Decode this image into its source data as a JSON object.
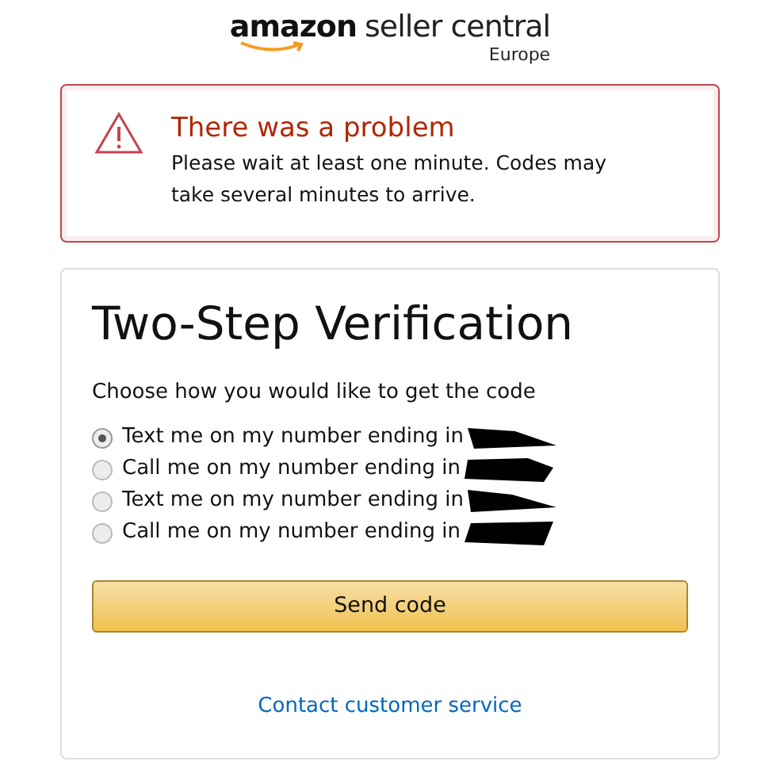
{
  "logo": {
    "brand": "amazon",
    "product": "seller central",
    "region": "Europe"
  },
  "alert": {
    "title": "There was a problem",
    "message": "Please wait at least one minute. Codes may take several minutes to arrive."
  },
  "card": {
    "title": "Two-Step Verification",
    "prompt": "Choose how you would like to get the code",
    "options": [
      {
        "label": "Text me on my number ending in",
        "selected": true
      },
      {
        "label": "Call me on my number ending in",
        "selected": false
      },
      {
        "label": "Text me on my number ending in",
        "selected": false
      },
      {
        "label": "Call me on my number ending in",
        "selected": false
      }
    ],
    "button": "Send code",
    "link": "Contact customer service"
  }
}
